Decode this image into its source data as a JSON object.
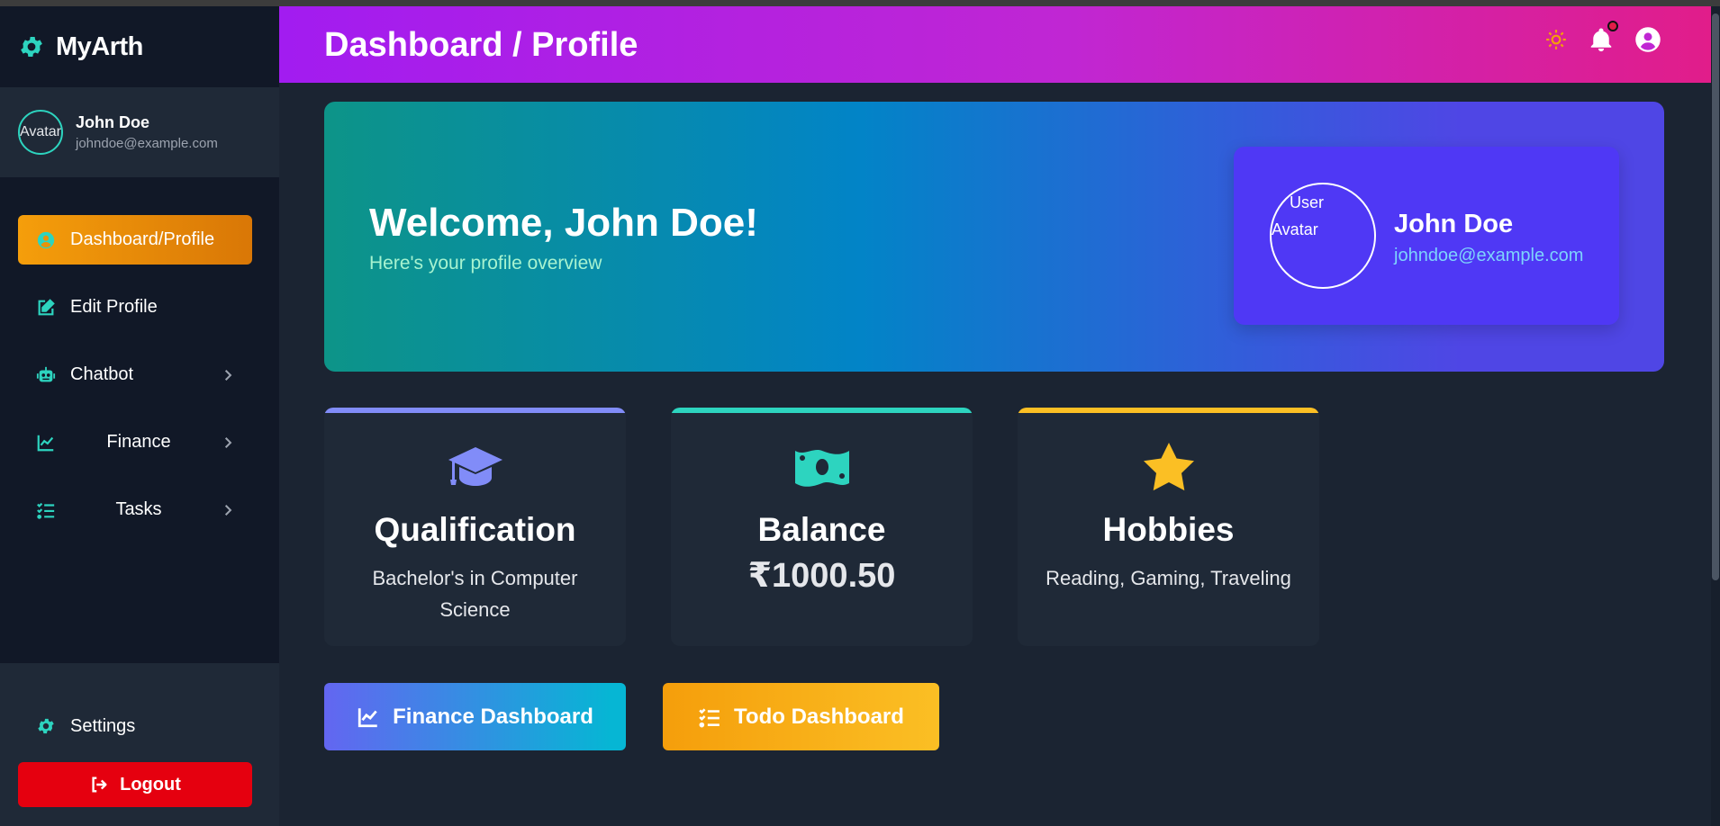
{
  "app": {
    "name": "MyArth"
  },
  "user": {
    "name": "John Doe",
    "email": "johndoe@example.com",
    "avatar_alt": "Avatar"
  },
  "sidebar": {
    "items": [
      {
        "label": "Dashboard/Profile",
        "icon": "user-circle-icon",
        "active": true
      },
      {
        "label": "Edit Profile",
        "icon": "edit-icon"
      },
      {
        "label": "Chatbot",
        "icon": "robot-icon",
        "has_submenu": true
      },
      {
        "label": "Finance",
        "icon": "chart-line-icon",
        "has_submenu": true
      },
      {
        "label": "Tasks",
        "icon": "tasks-icon",
        "has_submenu": true
      }
    ],
    "settings_label": "Settings",
    "logout_label": "Logout"
  },
  "header": {
    "title": "Dashboard / Profile"
  },
  "welcome": {
    "title": "Welcome, John Doe!",
    "subtitle": "Here's your profile overview",
    "avatar_alt_line1": "User",
    "avatar_alt_line2": "Avatar"
  },
  "cards": [
    {
      "title": "Qualification",
      "value": "Bachelor's in Computer Science",
      "icon": "graduation-cap-icon",
      "accent": "#818cf8"
    },
    {
      "title": "Balance",
      "value": "₹1000.50",
      "icon": "money-bill-icon",
      "accent": "#2dd4bf"
    },
    {
      "title": "Hobbies",
      "value": "Reading, Gaming, Traveling",
      "icon": "star-icon",
      "accent": "#fbbf24"
    }
  ],
  "buttons": {
    "finance": "Finance Dashboard",
    "todo": "Todo Dashboard"
  },
  "colors": {
    "accent": "#2dd4bf",
    "active": "#f59e0b",
    "logout": "#e5000f",
    "sidebar": "#111827",
    "main": "#1b2432"
  }
}
